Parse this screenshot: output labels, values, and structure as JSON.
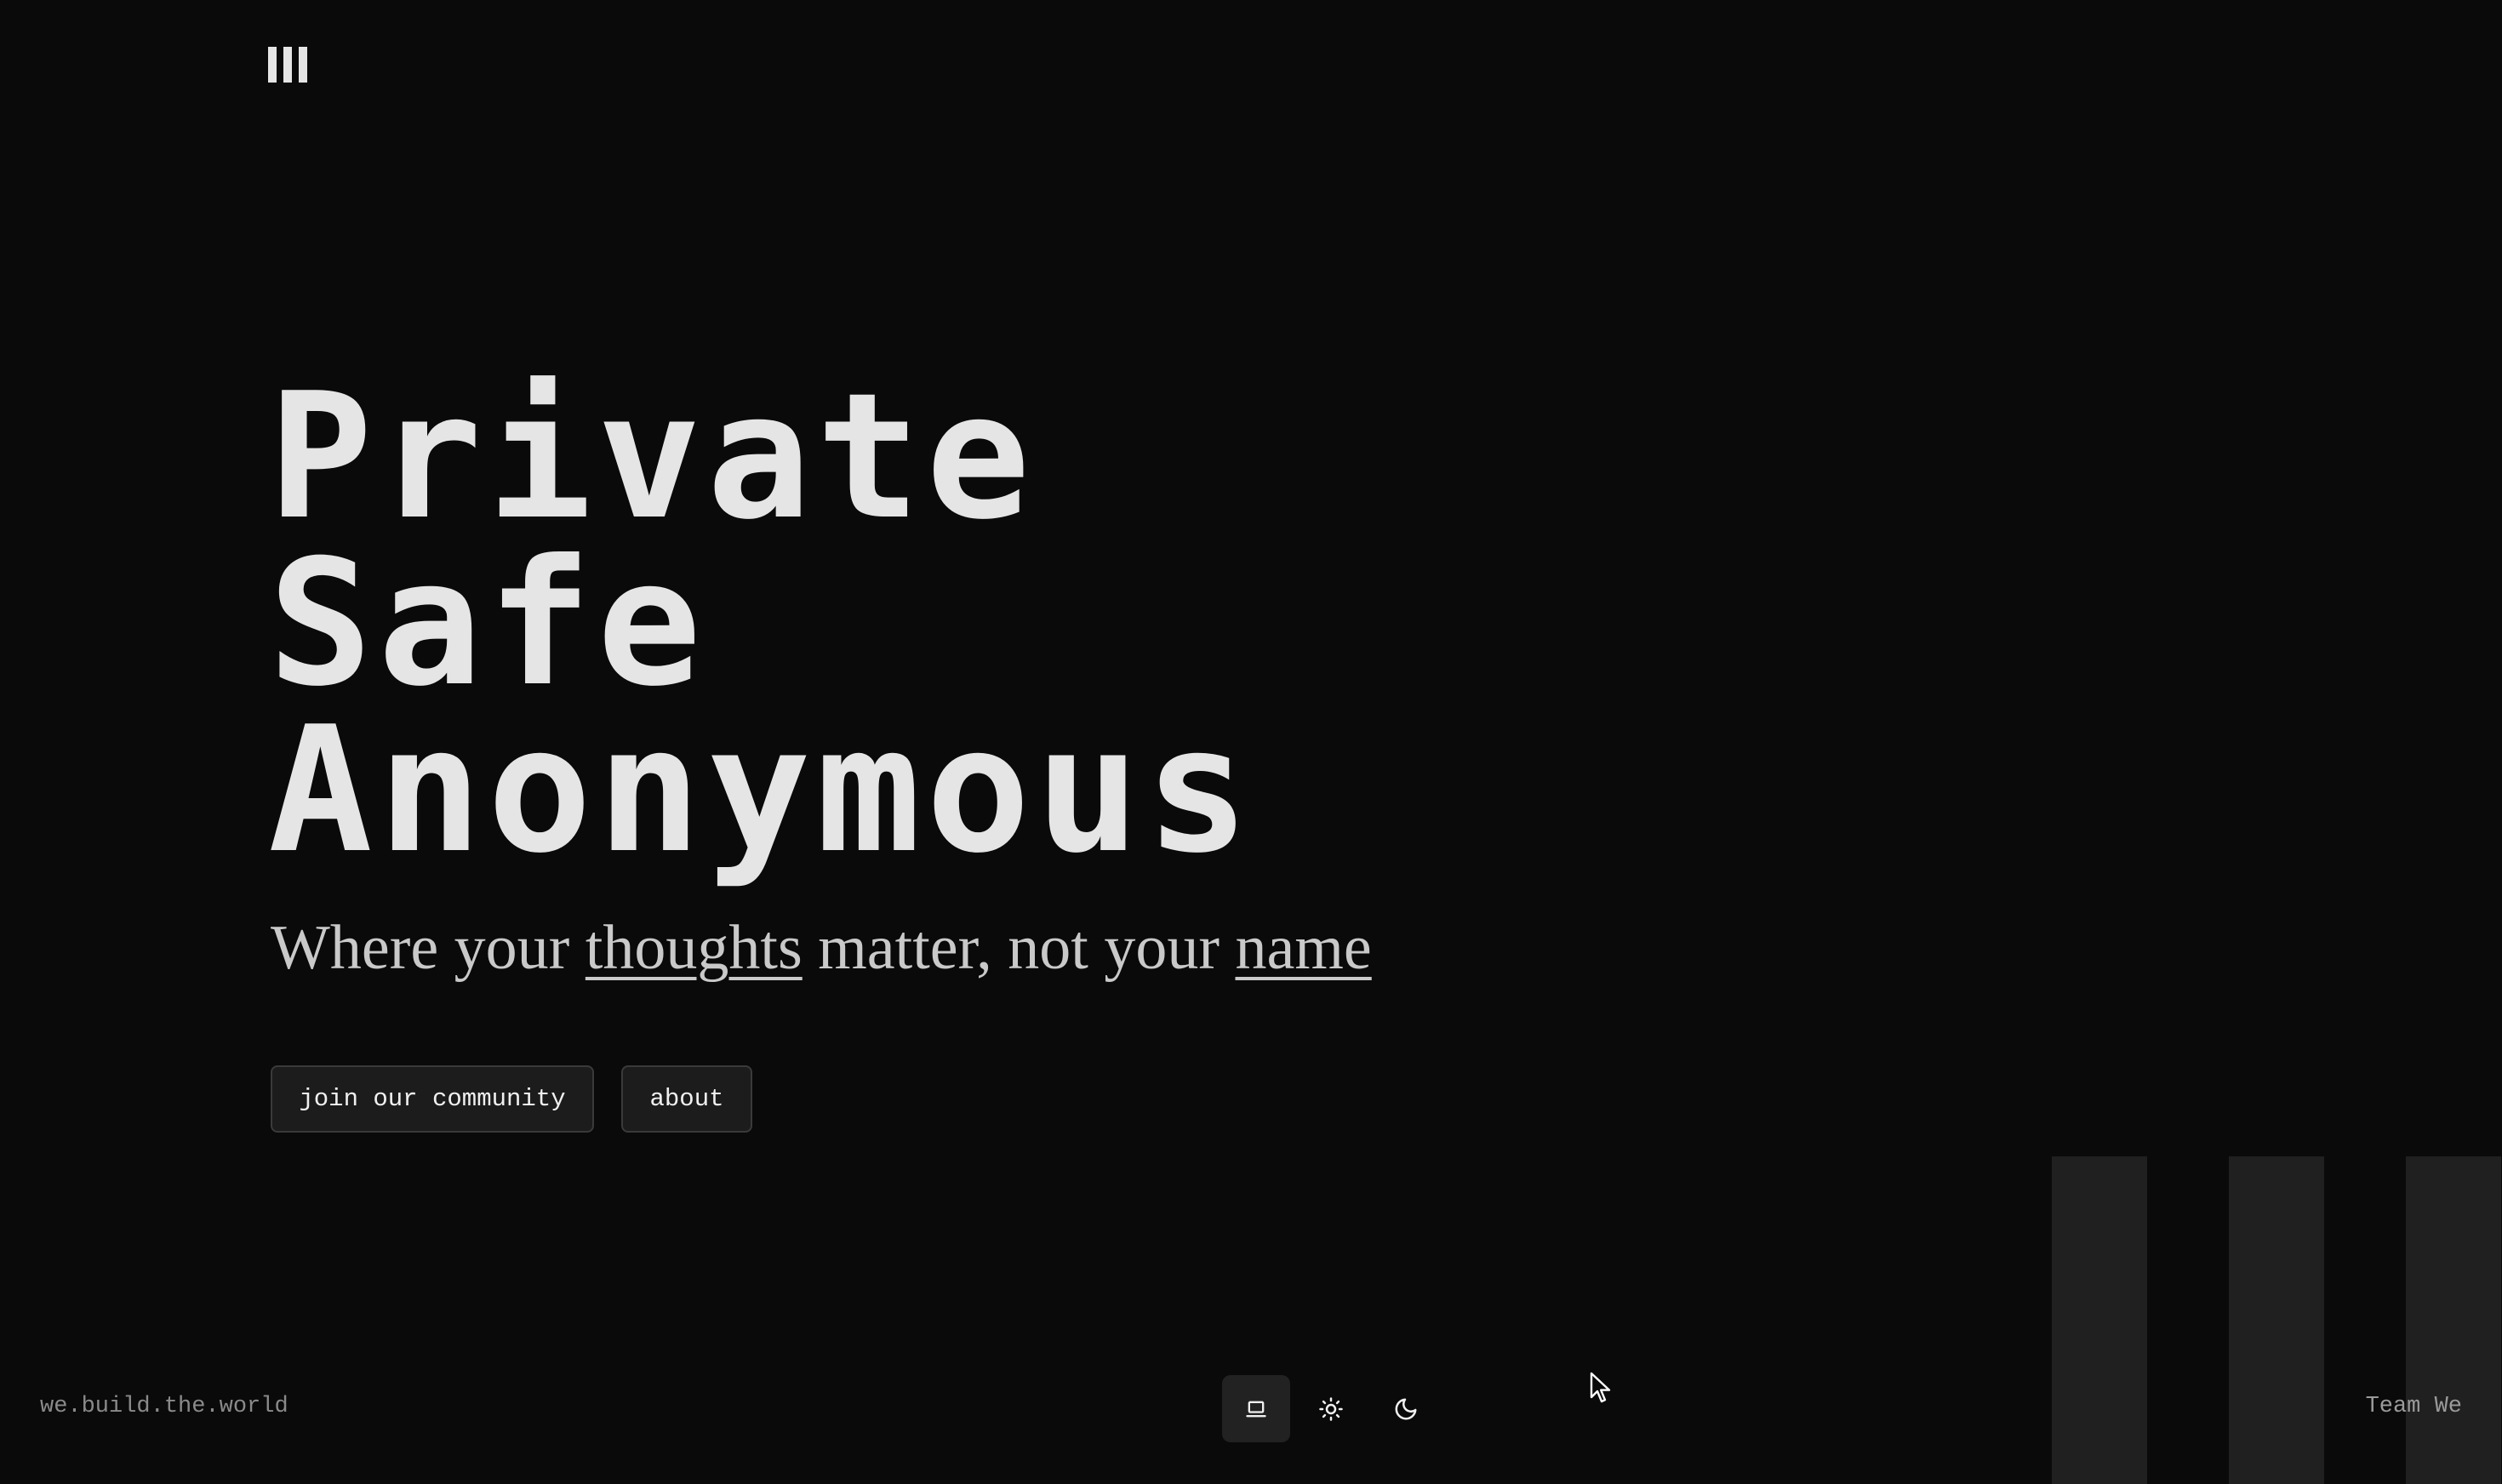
{
  "hero": {
    "lines": [
      "Private",
      "Safe",
      "Anonymous"
    ]
  },
  "tagline": {
    "part1": "Where your ",
    "link1": "thoughts",
    "part2": " matter, not your ",
    "link2": "name"
  },
  "buttons": {
    "join_label": "join our community",
    "about_label": "about"
  },
  "footer": {
    "left_text": "we.build.the.world",
    "right_text": "Team We"
  },
  "theme_switcher": {
    "options": [
      {
        "icon": "laptop-icon",
        "selected": true
      },
      {
        "icon": "sun-icon",
        "selected": false
      },
      {
        "icon": "moon-icon",
        "selected": false
      }
    ]
  },
  "colors": {
    "background": "#0a0a0a",
    "text": "#e5e5e5",
    "muted": "#8a8a8a",
    "button_bg": "#1c1c1c",
    "stripe": "#202020"
  }
}
